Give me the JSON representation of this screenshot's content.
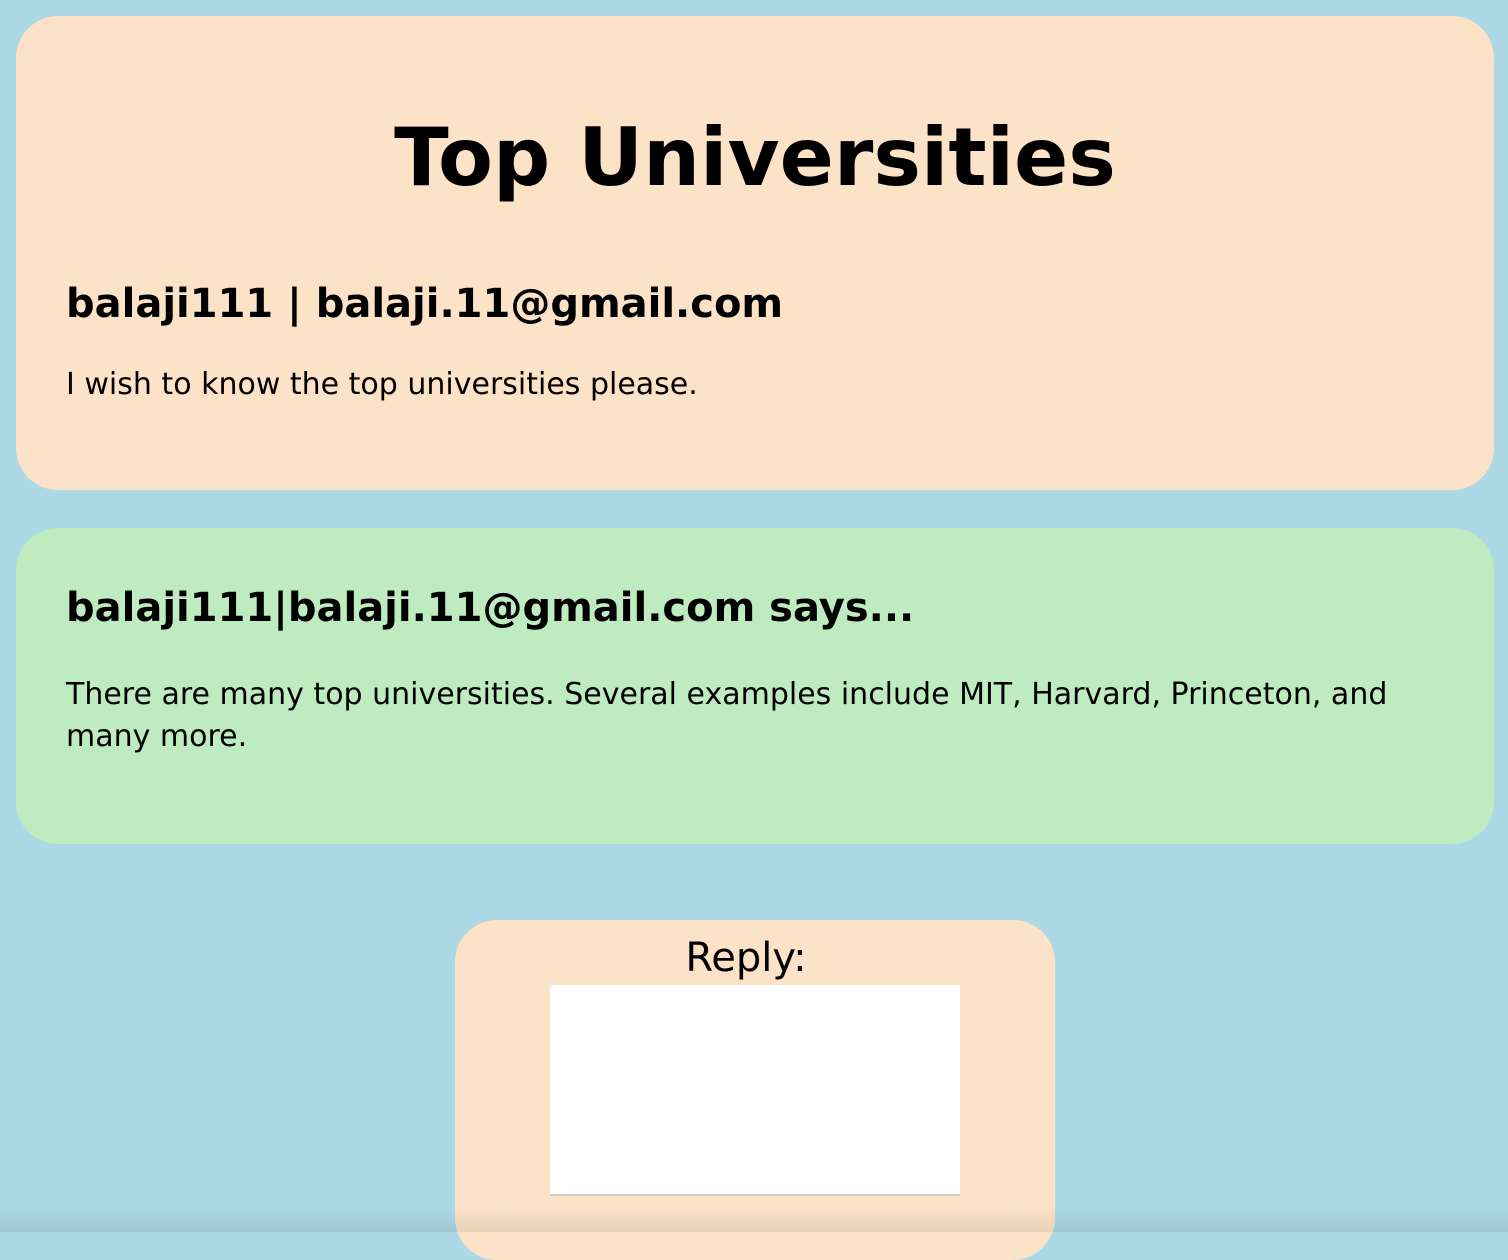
{
  "question": {
    "title": "Top Universities",
    "author_line": "balaji111 | balaji.11@gmail.com",
    "body": "I wish to know the top universities please."
  },
  "answers": [
    {
      "author_line": "balaji111|balaji.11@gmail.com says...",
      "body": "There are many top universities. Several examples include MIT, Harvard, Princeton, and many more."
    }
  ],
  "reply": {
    "label": "Reply:",
    "value": ""
  },
  "colors": {
    "page_background": "#add8e6",
    "question_card": "#fce3c7",
    "answer_card": "#beebbf",
    "reply_card": "#fce3c7"
  }
}
